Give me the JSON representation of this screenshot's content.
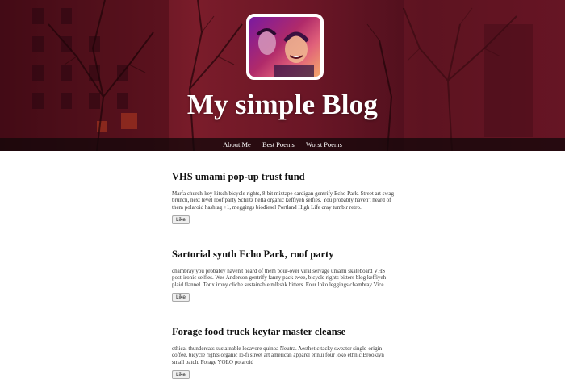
{
  "header": {
    "site_title": "My simple Blog",
    "avatar_alt": "avatar"
  },
  "nav": {
    "items": [
      {
        "label": "About Me"
      },
      {
        "label": "Best Poems"
      },
      {
        "label": "Worst Poems"
      }
    ]
  },
  "posts": [
    {
      "title": "VHS umami pop-up trust fund",
      "body": "Marfa church-key kitsch bicycle rights, 8-bit mixtape cardigan gentrify Echo Park. Street art swag brunch, next level roof party Schlitz hella organic keffiyeh selfies. You probably haven't heard of them polaroid hashtag +1, meggings biodiesel Portland High Life cray tumblr retro.",
      "like_label": "Like"
    },
    {
      "title": "Sartorial synth Echo Park, roof party",
      "body": "chambray you probably haven't heard of them pour-over viral selvage umami skateboard VHS post-ironic selfies. Wes Anderson gentrify fanny pack twee, bicycle rights bitters blog keffiyeh plaid flannel. Tonx irony cliche sustainable mlkshk bitters. Four loko leggings chambray Vice.",
      "like_label": "Like"
    },
    {
      "title": "Forage food truck keytar master cleanse",
      "body": "ethical thundercats sustainable locavore quinoa Neutra. Aesthetic tacky sweater single-origin coffee, bicycle rights organic lo-fi street art american apparel ennui four loko ethnic Brooklyn small batch. Forage YOLO polaroid",
      "like_label": "Like"
    }
  ]
}
